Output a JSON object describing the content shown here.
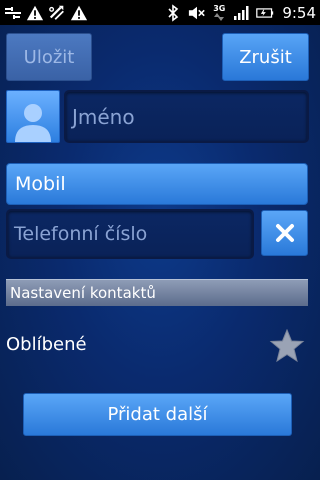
{
  "status_bar": {
    "icons_left": [
      "usb-debug-icon",
      "warning-icon",
      "sync-error-icon",
      "warning-icon"
    ],
    "icons_right": [
      "bluetooth-icon",
      "mute-icon",
      "3g-icon",
      "signal-icon",
      "battery-icon"
    ],
    "network": "3G",
    "time": "9:54"
  },
  "toolbar": {
    "save_label": "Uložit",
    "cancel_label": "Zrušit"
  },
  "contact": {
    "name_placeholder": "Jméno"
  },
  "phone": {
    "type_label": "Mobil",
    "number_placeholder": "Telefonní číslo"
  },
  "settings": {
    "section_title": "Nastavení kontaktů",
    "favorites_label": "Oblíbené"
  },
  "actions": {
    "add_more_label": "Přidat další"
  },
  "colors": {
    "background": "#0a2a6e",
    "button": "#2a79d9",
    "accent_light": "#5aa6f7"
  }
}
